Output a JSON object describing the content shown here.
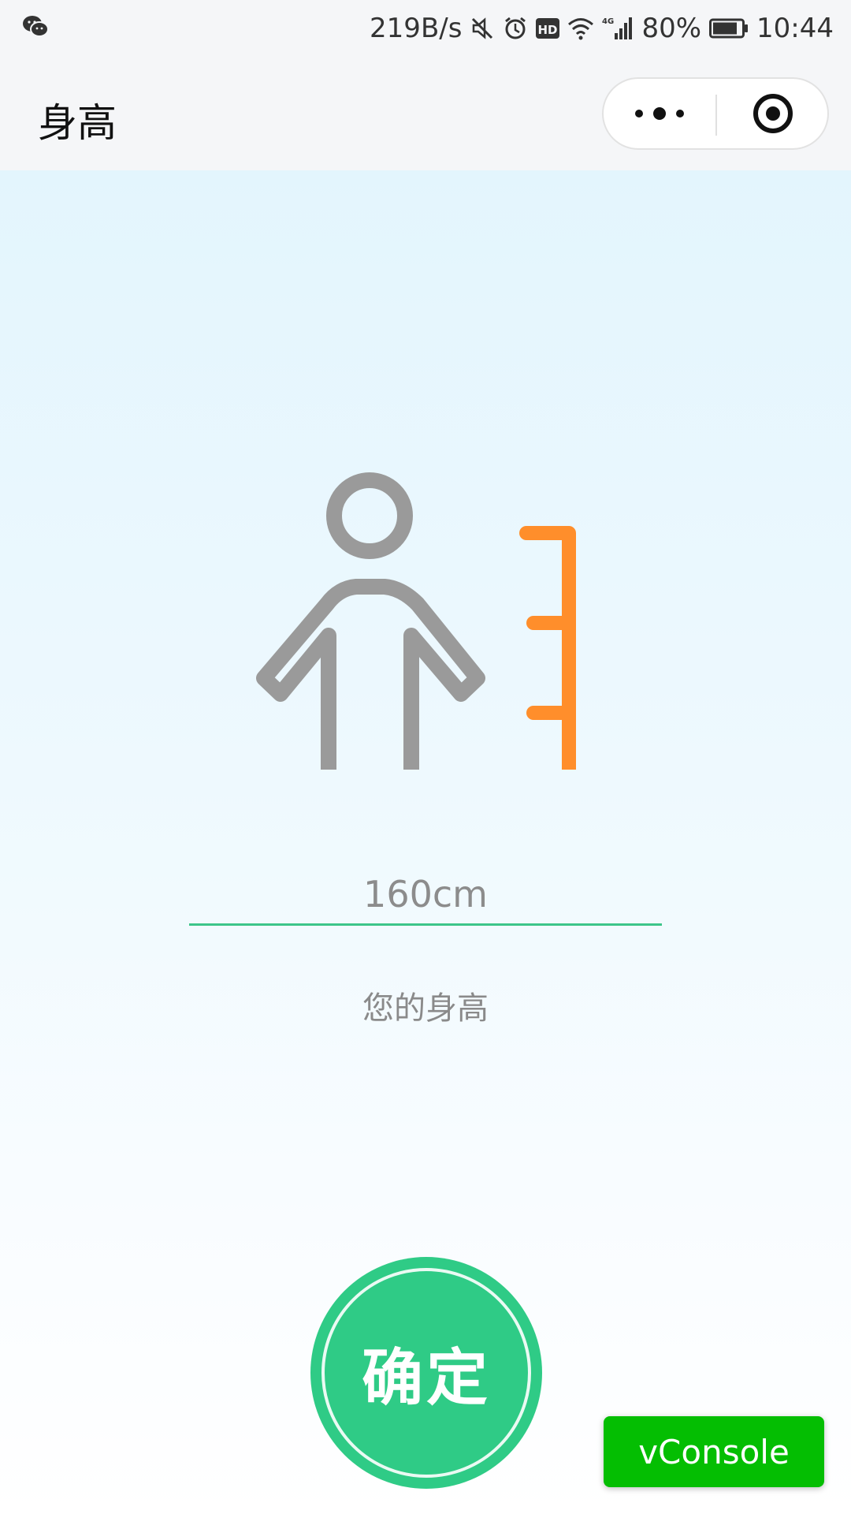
{
  "status_bar": {
    "network_speed": "219B/s",
    "battery_percent": "80%",
    "time": "10:44",
    "hd_badge": "HD",
    "network_type": "4G",
    "icons": [
      "wechat-icon",
      "mute-icon",
      "alarm-icon",
      "hd-icon",
      "wifi-icon",
      "signal-icon",
      "battery-icon"
    ]
  },
  "nav": {
    "title": "身高",
    "icons": [
      "more-icon",
      "close-target-icon"
    ]
  },
  "illustration": {
    "icons": [
      "person-icon",
      "height-ruler-icon"
    ],
    "colors": {
      "person": "#9a9a9a",
      "ruler": "#ff8e2b"
    }
  },
  "form": {
    "height_value": "160cm",
    "caption": "您的身高"
  },
  "confirm_label": "确定",
  "vconsole_label": "vConsole",
  "colors": {
    "accent_green": "#2fcb86",
    "underline": "#3dc58a",
    "vconsole_green": "#04be02"
  }
}
